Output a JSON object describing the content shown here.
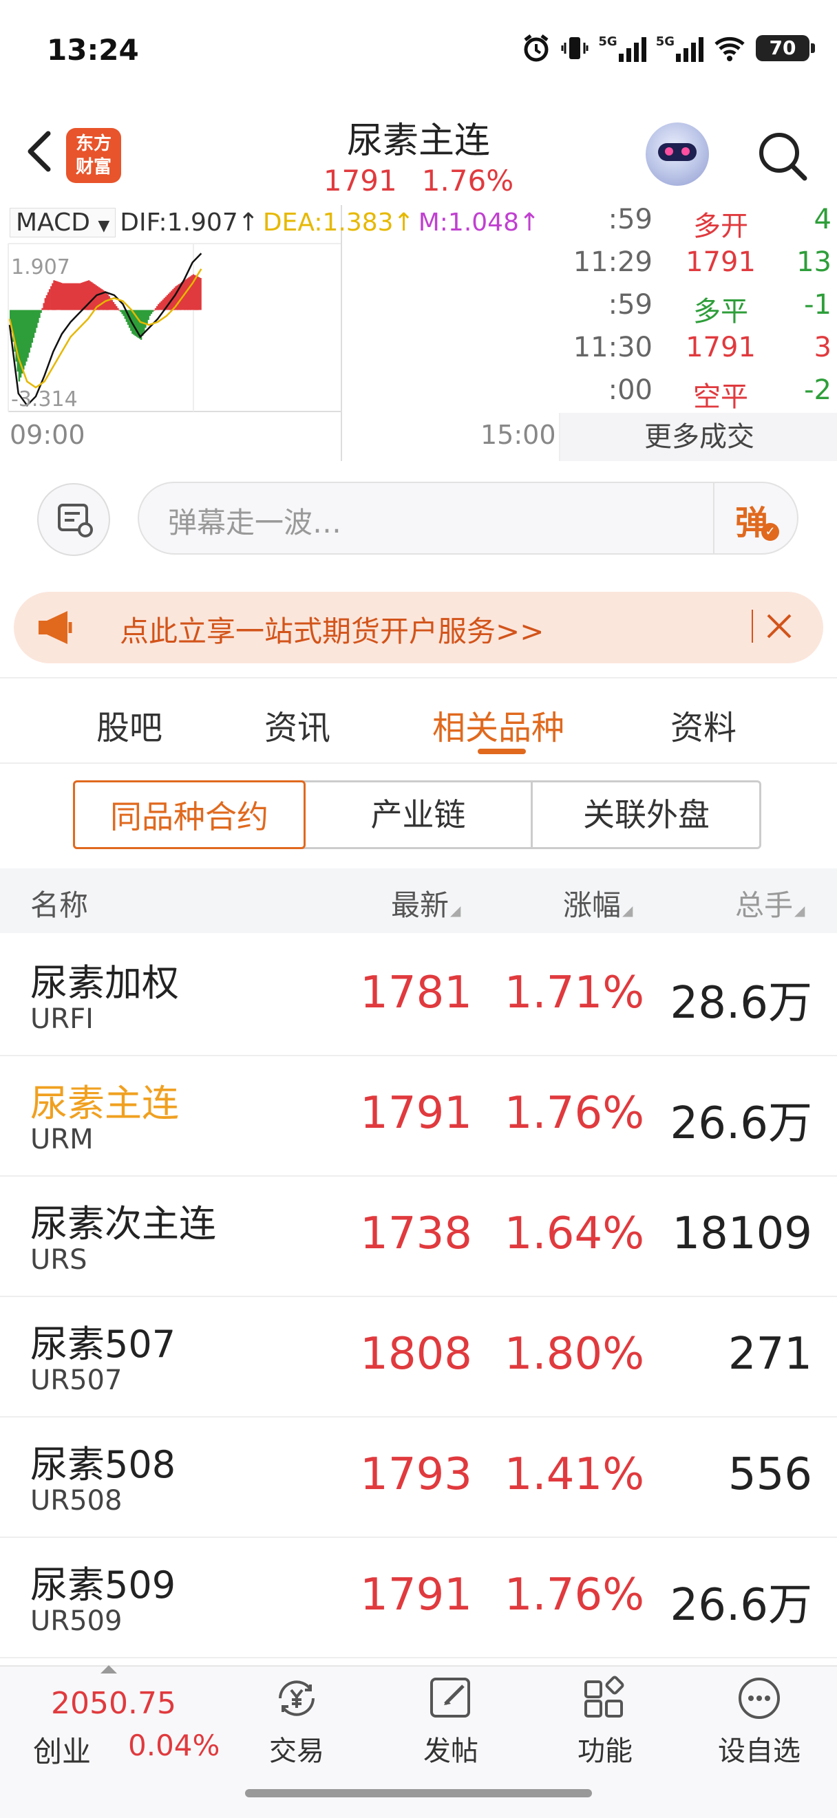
{
  "status_bar": {
    "time": "13:24",
    "battery": "70",
    "icons": [
      "alarm-icon",
      "vibrate-icon",
      "signal-5g-icon",
      "signal-5g-icon",
      "wifi-icon",
      "battery-icon"
    ],
    "net1": "5G",
    "net2": "5G"
  },
  "header": {
    "logo_line1": "东方",
    "logo_line2": "财富",
    "title": "尿素主连",
    "price": "1791",
    "change_pct": "1.76%"
  },
  "chart": {
    "indicator_name": "MACD",
    "dif": "DIF:1.907↑",
    "dea": "DEA:1.383↑",
    "m": "M:1.048↑",
    "y_max_label": "1.907",
    "y_min_label": "-3.314",
    "x_start": "09:00",
    "x_end": "15:00"
  },
  "chart_data": {
    "type": "bar",
    "title": "",
    "xlabel": "",
    "ylabel": "",
    "ylim": [
      -3.314,
      1.907
    ],
    "x_range": [
      "09:00",
      "15:00"
    ],
    "series": [
      {
        "name": "DIF",
        "type": "line",
        "color": "#111111",
        "values": [
          -0.5,
          -2.8,
          -3.2,
          -2.9,
          -2.2,
          -1.4,
          -0.8,
          -0.4,
          -0.1,
          0.2,
          0.5,
          0.6,
          0.5,
          0.2,
          -0.4,
          -0.9,
          -0.6,
          -0.3,
          0.1,
          0.5,
          1.0,
          1.6,
          1.9
        ]
      },
      {
        "name": "DEA",
        "type": "line",
        "color": "#e6b800",
        "values": [
          -0.3,
          -1.6,
          -2.4,
          -2.6,
          -2.4,
          -1.9,
          -1.4,
          -0.9,
          -0.6,
          -0.3,
          0.1,
          0.3,
          0.4,
          0.3,
          0.0,
          -0.4,
          -0.5,
          -0.4,
          -0.2,
          0.1,
          0.5,
          0.9,
          1.38
        ]
      },
      {
        "name": "M",
        "type": "bar",
        "values": [
          -0.4,
          -2.4,
          -1.6,
          -0.6,
          0.4,
          1.0,
          0.9,
          0.9,
          0.9,
          1.0,
          0.8,
          0.6,
          0.2,
          -0.2,
          -0.8,
          -1.0,
          -0.2,
          0.2,
          0.5,
          0.8,
          1.0,
          1.2,
          1.05
        ]
      }
    ]
  },
  "trades": [
    {
      "time": ":59",
      "price": "多开",
      "vol": "4",
      "price_color": "#e03a3e",
      "vol_color": "#2e9e3a"
    },
    {
      "time": "11:29",
      "price": "1791",
      "vol": "13",
      "price_color": "#e03a3e",
      "vol_color": "#2e9e3a"
    },
    {
      "time": ":59",
      "price": "多平",
      "vol": "-1",
      "price_color": "#2e9e3a",
      "vol_color": "#2e9e3a"
    },
    {
      "time": "11:30",
      "price": "1791",
      "vol": "3",
      "price_color": "#e03a3e",
      "vol_color": "#e03a3e"
    },
    {
      "time": ":00",
      "price": "空平",
      "vol": "-2",
      "price_color": "#e03a3e",
      "vol_color": "#2e9e3a"
    }
  ],
  "more_trades_label": "更多成交",
  "danmaku": {
    "placeholder": "弹幕走一波…",
    "button_label": "弹"
  },
  "promo": {
    "text": "点此立享一站式期货开户服务>>"
  },
  "tabs": [
    {
      "label": "股吧",
      "active": false
    },
    {
      "label": "资讯",
      "active": false
    },
    {
      "label": "相关品种",
      "active": true
    },
    {
      "label": "资料",
      "active": false
    }
  ],
  "segments": [
    {
      "label": "同品种合约",
      "active": true
    },
    {
      "label": "产业链",
      "active": false
    },
    {
      "label": "关联外盘",
      "active": false
    }
  ],
  "table": {
    "headers": {
      "name": "名称",
      "last": "最新",
      "change": "涨幅",
      "volume": "总手"
    },
    "rows": [
      {
        "name": "尿素加权",
        "code": "URFI",
        "last": "1781",
        "change": "1.71%",
        "volume": "28.6万"
      },
      {
        "name": "尿素主连",
        "code": "URM",
        "last": "1791",
        "change": "1.76%",
        "volume": "26.6万"
      },
      {
        "name": "尿素次主连",
        "code": "URS",
        "last": "1738",
        "change": "1.64%",
        "volume": "18109"
      },
      {
        "name": "尿素507",
        "code": "UR507",
        "last": "1808",
        "change": "1.80%",
        "volume": "271"
      },
      {
        "name": "尿素508",
        "code": "UR508",
        "last": "1793",
        "change": "1.41%",
        "volume": "556"
      },
      {
        "name": "尿素509",
        "code": "UR509",
        "last": "1791",
        "change": "1.76%",
        "volume": "26.6万"
      }
    ]
  },
  "bottom_bar": {
    "index_value": "2050.75",
    "index_name": "创业",
    "index_change": "0.04%",
    "items": [
      {
        "label": "交易",
        "icon": "trade-yen-icon"
      },
      {
        "label": "发帖",
        "icon": "post-edit-icon"
      },
      {
        "label": "功能",
        "icon": "grid-apps-icon"
      },
      {
        "label": "设自选",
        "icon": "more-dots-icon"
      }
    ]
  },
  "colors": {
    "up": "#e03a3e",
    "down": "#2e9e3a",
    "accent": "#e0691e",
    "highlight": "#f0a020"
  }
}
